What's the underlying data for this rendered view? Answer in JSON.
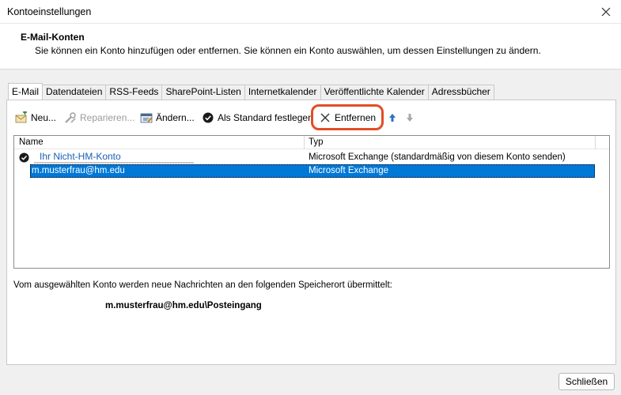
{
  "window": {
    "title": "Kontoeinstellungen"
  },
  "header": {
    "title": "E-Mail-Konten",
    "description": "Sie können ein Konto hinzufügen oder entfernen. Sie können ein Konto auswählen, um dessen Einstellungen zu ändern."
  },
  "tabs": [
    {
      "label": "E-Mail",
      "active": true
    },
    {
      "label": "Datendateien"
    },
    {
      "label": "RSS-Feeds"
    },
    {
      "label": "SharePoint-Listen"
    },
    {
      "label": "Internetkalender"
    },
    {
      "label": "Veröffentlichte Kalender"
    },
    {
      "label": "Adressbücher"
    }
  ],
  "toolbar": {
    "new_label": "Neu...",
    "repair_label": "Reparieren...",
    "change_label": "Ändern...",
    "set_default_label": "Als Standard festlegen",
    "remove_label": "Entfernen",
    "highlight_color": "#e34d25"
  },
  "list": {
    "columns": {
      "name": "Name",
      "type": "Typ"
    },
    "rows": [
      {
        "name": "Ihr Nicht-HM-Konto",
        "type": "Microsoft Exchange (standardmäßig von diesem Konto senden)",
        "is_default": true
      },
      {
        "name": "m.musterfrau@hm.edu",
        "type": "Microsoft Exchange",
        "selected": true
      }
    ],
    "selection_color": "#0078d7"
  },
  "delivery": {
    "info": "Vom ausgewählten Konto werden neue Nachrichten an den folgenden Speicherort übermittelt:",
    "location": "m.musterfrau@hm.edu\\Posteingang"
  },
  "footer": {
    "close_label": "Schließen"
  }
}
